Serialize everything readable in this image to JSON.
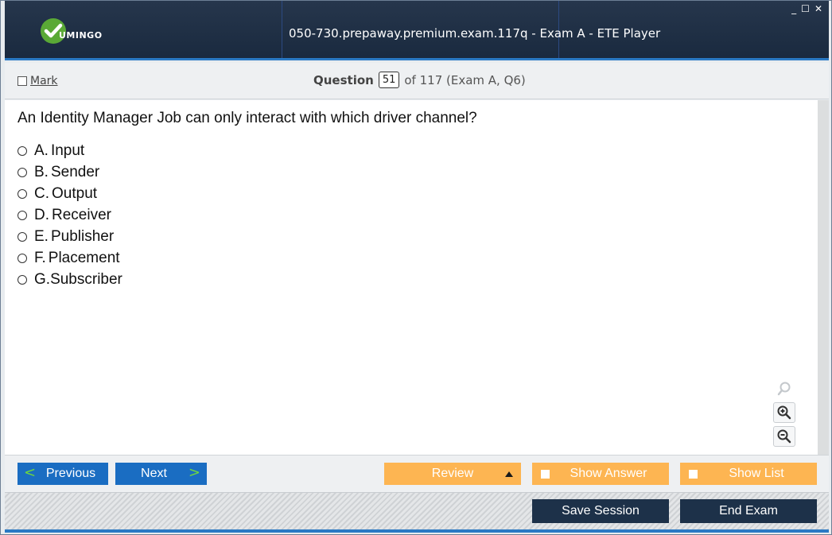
{
  "app": {
    "window_title": "050-730.prepaway.premium.exam.117q - Exam A - ETE Player",
    "logo_text": "UMINGO",
    "controls": {
      "minimize": "_",
      "maximize": "☐",
      "close": "✕"
    }
  },
  "header": {
    "mark_label": "Mark",
    "question_label": "Question",
    "question_number": "51",
    "question_suffix": "of 117 (Exam A, Q6)"
  },
  "question": {
    "text": "An Identity Manager Job can only interact with which driver channel?",
    "options": [
      {
        "letter": "A.",
        "text": "Input"
      },
      {
        "letter": "B.",
        "text": "Sender"
      },
      {
        "letter": "C.",
        "text": "Output"
      },
      {
        "letter": "D.",
        "text": "Receiver"
      },
      {
        "letter": "E.",
        "text": "Publisher"
      },
      {
        "letter": "F.",
        "text": "Placement"
      },
      {
        "letter": "G.",
        "text": "Subscriber"
      }
    ]
  },
  "nav": {
    "previous_label": "Previous",
    "next_label": "Next",
    "review_label": "Review",
    "show_answer_label": "Show Answer",
    "show_list_label": "Show List"
  },
  "actions": {
    "save_session_label": "Save Session",
    "end_exam_label": "End Exam"
  },
  "colors": {
    "title_bar": "#1f2f45",
    "accent_blue": "#1a6dc2",
    "accent_orange": "#fdb552",
    "dark_button": "#1d3149",
    "logo_green": "#5aa936",
    "chevron_green": "#6fd63f"
  },
  "icons": {
    "zoom_search": "magnifier-icon",
    "zoom_in": "zoom-in-icon",
    "zoom_out": "zoom-out-icon"
  }
}
